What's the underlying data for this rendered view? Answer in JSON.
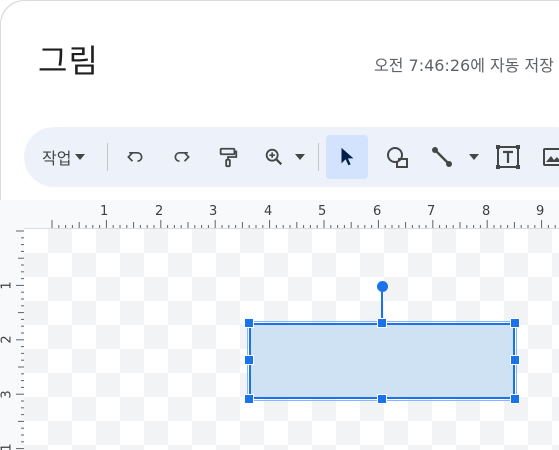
{
  "dialog": {
    "title": "그림",
    "autosave_status": "오전 7:46:26에 자동 저장"
  },
  "toolbar": {
    "actions_label": "작업",
    "buttons": [
      {
        "name": "undo",
        "icon": "undo-icon"
      },
      {
        "name": "redo",
        "icon": "redo-icon"
      },
      {
        "name": "paint-format",
        "icon": "paint-format-icon"
      },
      {
        "name": "zoom",
        "icon": "zoom-icon",
        "has_dropdown": true
      },
      {
        "name": "select",
        "icon": "cursor-icon",
        "active": true
      },
      {
        "name": "shape",
        "icon": "shape-icon"
      },
      {
        "name": "line",
        "icon": "line-icon",
        "has_dropdown": true
      },
      {
        "name": "text-box",
        "icon": "text-box-icon"
      },
      {
        "name": "image",
        "icon": "image-icon"
      }
    ]
  },
  "rulers": {
    "horizontal": [
      "1",
      "2",
      "3",
      "4",
      "5",
      "6",
      "7",
      "8",
      "9"
    ],
    "vertical": [
      "1",
      "2",
      "3",
      "1"
    ]
  },
  "colors": {
    "accent": "#1a73e8",
    "shape_fill": "#cfe2f3",
    "toolbar_bg": "#edf2fa",
    "active_tool_bg": "#d3e3fd"
  }
}
